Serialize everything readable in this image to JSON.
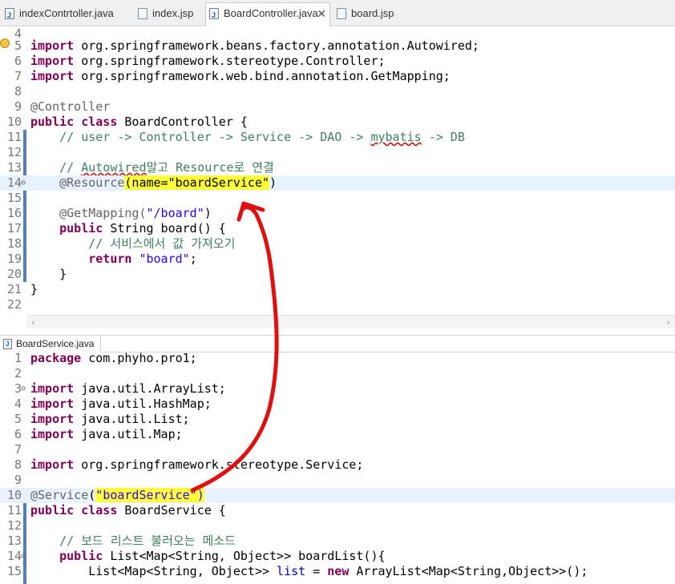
{
  "tabs": [
    {
      "label": "indexContrtoller.java",
      "type": "java"
    },
    {
      "label": "index.jsp",
      "type": "jsp"
    },
    {
      "label": "BoardController.java",
      "type": "java",
      "active": true
    },
    {
      "label": "board.jsp",
      "type": "jsp"
    }
  ],
  "tab_close_glyph": "✕",
  "editor_top": {
    "lines": [
      {
        "num": "4"
      },
      {
        "num": "5"
      },
      {
        "num": "6"
      },
      {
        "num": "7"
      },
      {
        "num": "8"
      },
      {
        "num": "9"
      },
      {
        "num": "10"
      },
      {
        "num": "11"
      },
      {
        "num": "12"
      },
      {
        "num": "13"
      },
      {
        "num": "14"
      },
      {
        "num": "15"
      },
      {
        "num": "16"
      },
      {
        "num": "17"
      },
      {
        "num": "18"
      },
      {
        "num": "19"
      },
      {
        "num": "20"
      },
      {
        "num": "21"
      },
      {
        "num": "22"
      }
    ],
    "text": {
      "import_kw": "import",
      "imp1": " org.springframework.beans.factory.annotation.Autowired;",
      "imp2": " org.springframework.stereotype.Controller;",
      "imp3": " org.springframework.web.bind.annotation.GetMapping;",
      "controller_ann": "@Controller",
      "public_kw": "public",
      "class_kw": " class",
      "class_name": " BoardController {",
      "comment1_a": "    // user -> Controller -> Service -> DAO -> ",
      "comment1_b": "mybatis",
      "comment1_c": " -> DB",
      "comment2_a": "    // ",
      "comment2_b": "Autowired",
      "comment2_c": "말고 Resource로 연결",
      "resource_ann": "    @Resource",
      "resource_args": "(name=\"boardService\"",
      "resource_close": ")",
      "getmapping": "    @GetMapping(",
      "getmapping_str": "\"/board\"",
      "getmapping_close": ")",
      "method_public": "    public",
      "method_sig": " String board() {",
      "comment3": "        // 서비스에서 값 가져오기",
      "return_kw": "        return",
      "return_val": " \"board\"",
      "return_semi": ";",
      "brace_inner": "    }",
      "brace_outer": "}"
    }
  },
  "editor_bottom": {
    "file_tab": "BoardService.java",
    "lines": [
      {
        "num": "1"
      },
      {
        "num": "2"
      },
      {
        "num": "3"
      },
      {
        "num": "4"
      },
      {
        "num": "5"
      },
      {
        "num": "6"
      },
      {
        "num": "7"
      },
      {
        "num": "8"
      },
      {
        "num": "9"
      },
      {
        "num": "10"
      },
      {
        "num": "11"
      },
      {
        "num": "12"
      },
      {
        "num": "13"
      },
      {
        "num": "14"
      },
      {
        "num": "15"
      }
    ],
    "text": {
      "package_kw": "package",
      "package_name": " com.phyho.pro1;",
      "import_kw": "import",
      "imp1": " java.util.ArrayList;",
      "imp2": " java.util.HashMap;",
      "imp3": " java.util.List;",
      "imp4": " java.util.Map;",
      "imp5": " org.springframework.stereotype.Service;",
      "service_ann": "@Service",
      "service_open": "(",
      "service_str": "\"boardService\")",
      "public_kw": "public",
      "class_kw": " class",
      "class_name": " BoardService {",
      "comment": "    // 보드 리스트 불러오는 메소드",
      "method_public": "    public",
      "method_sig": " List<Map<String, Object>> boardList(){",
      "body_a": "        List<Map<String, Object>> ",
      "body_list": "list",
      "body_b": " = ",
      "new_kw": "new",
      "body_c": " ArrayList<Map<String,Object>>();"
    }
  },
  "scroll_left_glyph": "‹",
  "scroll_right_glyph": "›",
  "colors": {
    "keyword": "#7f0055",
    "comment": "#3f7f5f",
    "string": "#2a00ff",
    "annotation": "#646464",
    "highlight": "#ffff3a",
    "current_line": "#e8f2fe",
    "arrow": "#e01010"
  }
}
